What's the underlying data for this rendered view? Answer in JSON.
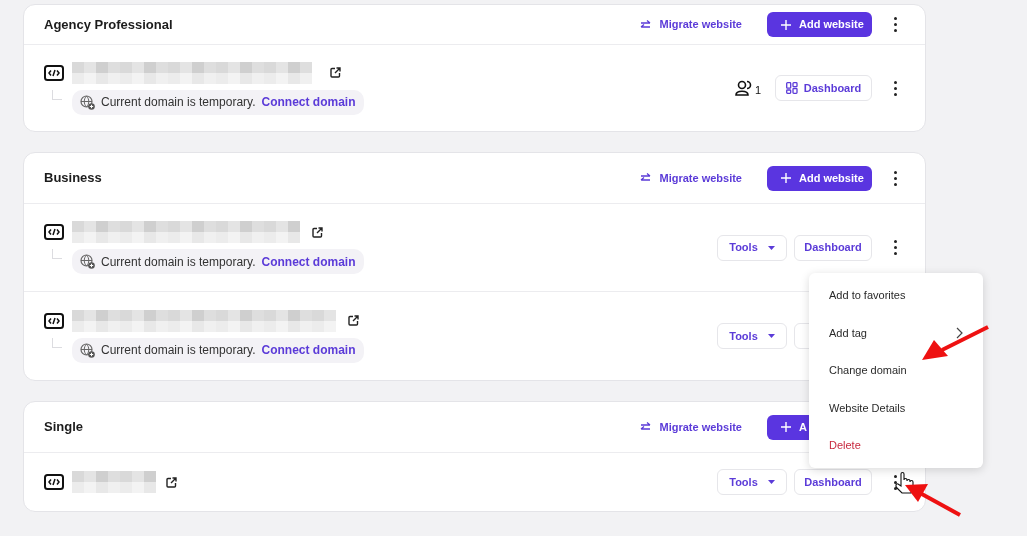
{
  "sections": [
    {
      "title": "Agency Professional",
      "migrate": "Migrate website",
      "add": "Add website",
      "more": true,
      "sites": [
        {
          "notice": "Current domain is temporary.",
          "link": "Connect domain",
          "more": true,
          "actions": [
            {
              "kind": "users",
              "count": "1"
            },
            {
              "kind": "dashboard_icon",
              "label": "Dashboard"
            }
          ]
        }
      ]
    },
    {
      "title": "Business",
      "migrate": "Migrate website",
      "add": "Add website",
      "more": true,
      "sites": [
        {
          "notice": "Current domain is temporary.",
          "link": "Connect domain",
          "more": true,
          "actions": [
            {
              "kind": "tools",
              "label": "Tools"
            },
            {
              "kind": "dashboard",
              "label": "Dashboard"
            }
          ]
        },
        {
          "notice": "Current domain is temporary.",
          "link": "Connect domain",
          "actions": [
            {
              "kind": "tools",
              "label": "Tools"
            },
            {
              "kind": "dashboard_hidden"
            }
          ]
        }
      ]
    },
    {
      "title": "Single",
      "migrate": "Migrate website",
      "add": "A",
      "more": false,
      "sites": [
        {
          "more": true,
          "actions": [
            {
              "kind": "tools",
              "label": "Tools"
            },
            {
              "kind": "dashboard",
              "label": "Dashboard"
            }
          ]
        }
      ]
    }
  ],
  "menu": {
    "items": [
      {
        "label": "Add to favorites",
        "kind": "plain"
      },
      {
        "label": "Add tag",
        "kind": "submenu"
      },
      {
        "label": "Change domain",
        "kind": "plain"
      },
      {
        "label": "Website Details",
        "kind": "plain"
      },
      {
        "label": "Delete",
        "kind": "danger"
      }
    ]
  }
}
